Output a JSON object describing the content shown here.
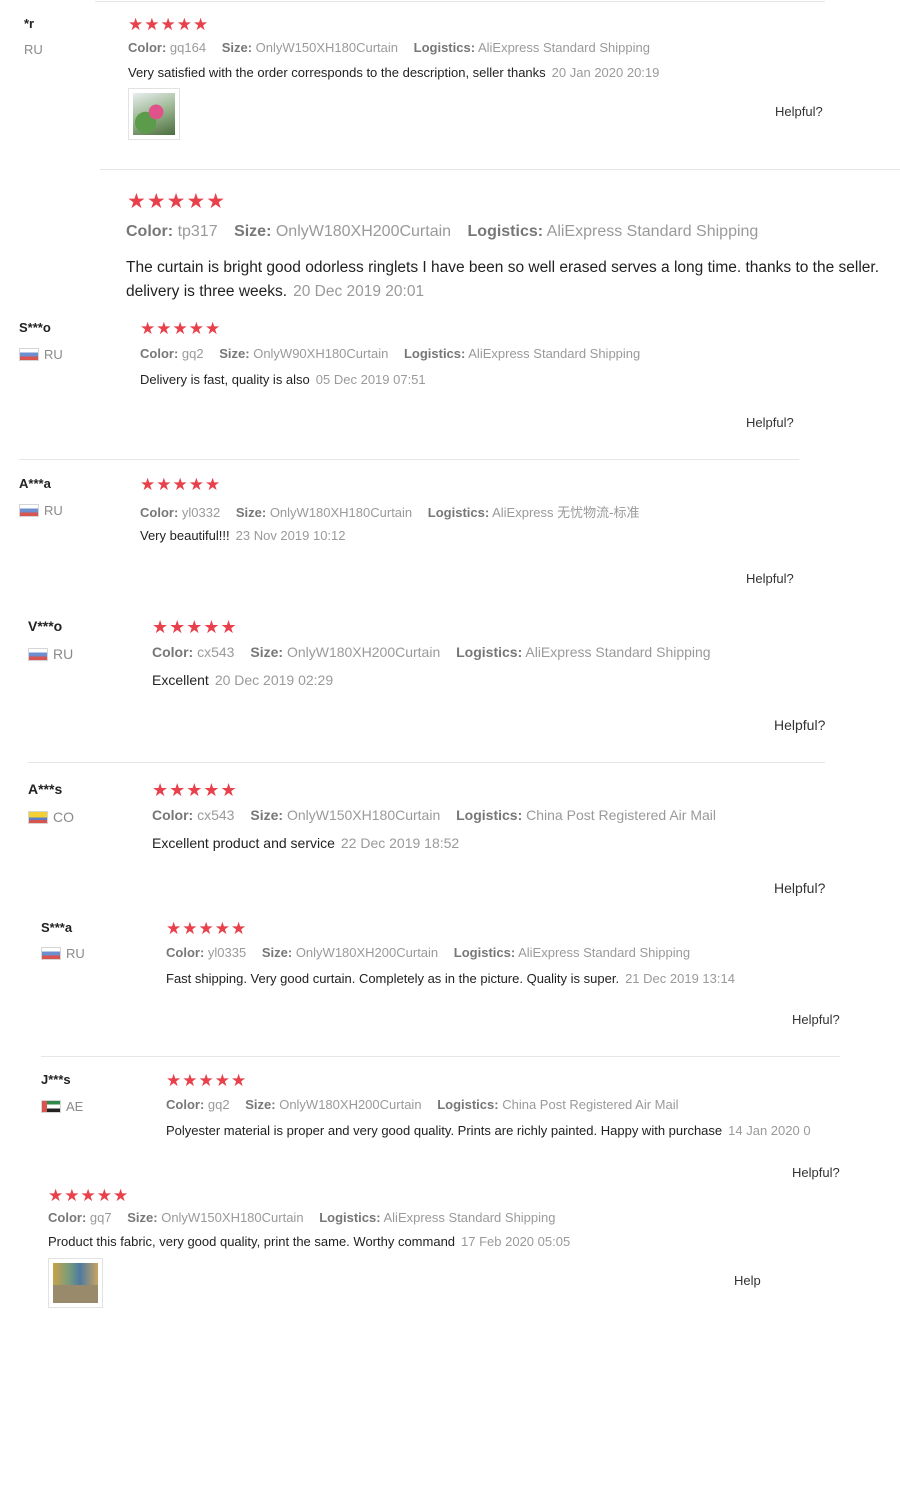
{
  "labels": {
    "color": "Color:",
    "size": "Size:",
    "logistics": "Logistics:",
    "helpful": "Helpful?"
  },
  "colors": {
    "star": "#e8414c",
    "divider": "#e6e6e6",
    "meta": "#9a9a9a"
  },
  "reviews": [
    {
      "user": "*r",
      "country": "RU",
      "stars": "★★★★★",
      "color": "gq164",
      "size": "OnlyW150XH180Curtain",
      "logistics": "AliExpress Standard Shipping",
      "text": "Very satisfied with the order corresponds to the description, seller thanks",
      "date": "20 Jan 2020 20:19",
      "helpful": "Helpful?",
      "photo_icon": "flowers-photo"
    },
    {
      "user": "",
      "country": "",
      "stars": "★★★★★",
      "color": "tp317",
      "size": "OnlyW180XH200Curtain",
      "logistics": "AliExpress Standard Shipping",
      "text": "The curtain is bright good odorless ringlets I have been so well erased serves a long time. thanks to the seller. delivery is three weeks.",
      "date": "20 Dec 2019 20:01",
      "helpful": ""
    },
    {
      "user": "S***o",
      "country": "RU",
      "stars": "★★★★★",
      "color": "gq2",
      "size": "OnlyW90XH180Curtain",
      "logistics": "AliExpress Standard Shipping",
      "text": "Delivery is fast, quality is also",
      "date": "05 Dec 2019 07:51",
      "helpful": "Helpful?"
    },
    {
      "user": "A***a",
      "country": "RU",
      "stars": "★★★★★",
      "color": "yl0332",
      "size": "OnlyW180XH180Curtain",
      "logistics": "AliExpress 无忧物流-标准",
      "text": "Very beautiful!!!",
      "date": "23 Nov 2019 10:12",
      "helpful": "Helpful?"
    },
    {
      "user": "V***o",
      "country": "RU",
      "stars": "★★★★★",
      "color": "cx543",
      "size": "OnlyW180XH200Curtain",
      "logistics": "AliExpress Standard Shipping",
      "text": "Excellent",
      "date": "20 Dec 2019 02:29",
      "helpful": "Helpful?"
    },
    {
      "user": "A***s",
      "country": "CO",
      "stars": "★★★★★",
      "color": "cx543",
      "size": "OnlyW150XH180Curtain",
      "logistics": "China Post Registered Air Mail",
      "text": "Excellent product and service",
      "date": "22 Dec 2019 18:52",
      "helpful": "Helpful?"
    },
    {
      "user": "S***a",
      "country": "RU",
      "stars": "★★★★★",
      "color": "yl0335",
      "size": "OnlyW180XH200Curtain",
      "logistics": "AliExpress Standard Shipping",
      "text": "Fast shipping. Very good curtain. Completely as in the picture. Quality is super.",
      "date": "21 Dec 2019 13:14",
      "helpful": "Helpful?"
    },
    {
      "user": "J***s",
      "country": "AE",
      "stars": "★★★★★",
      "color": "gq2",
      "size": "OnlyW180XH200Curtain",
      "logistics": "China Post Registered Air Mail",
      "text": "Polyester material is proper and very good quality. Prints are richly painted. Happy with purchase",
      "date": "14 Jan 2020 0",
      "helpful": "Helpful?"
    },
    {
      "user": "",
      "country": "",
      "stars": "★★★★★",
      "color": "gq7",
      "size": "OnlyW150XH180Curtain",
      "logistics": "AliExpress Standard Shipping",
      "text": "Product this fabric, very good quality, print the same. Worthy command",
      "date": "17 Feb 2020 05:05",
      "helpful": "Help",
      "photo_icon": "room-photo"
    }
  ]
}
